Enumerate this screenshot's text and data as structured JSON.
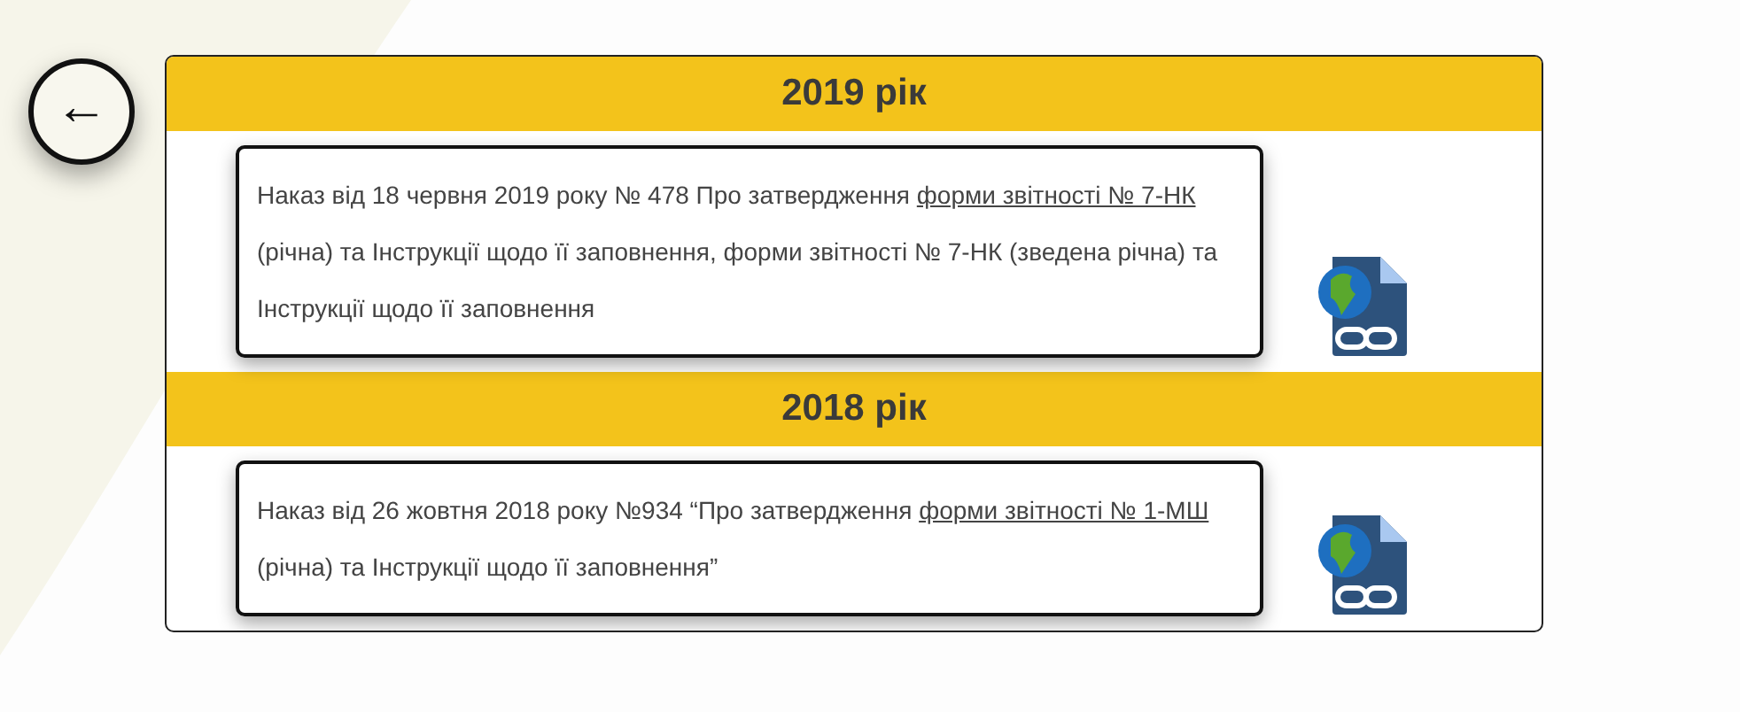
{
  "back_button": {
    "symbol": "←"
  },
  "sections": [
    {
      "year": "2019 рік",
      "order": {
        "before": "Наказ від 18 червня 2019 року № 478 Про затвердження ",
        "link": "форми звітності № 7-НК",
        "after": " (річна) та Інструкції щодо її заповнення, форми звітності № 7-НК (зведена річна) та Інструкції щодо її заповнення"
      }
    },
    {
      "year": "2018 рік",
      "order": {
        "before": "Наказ від 26 жовтня 2018 року №934 “Про затвердження ",
        "link": "форми звітності № 1-МШ",
        "after": " (річна) та Інструкції щодо її заповнення”"
      }
    }
  ]
}
